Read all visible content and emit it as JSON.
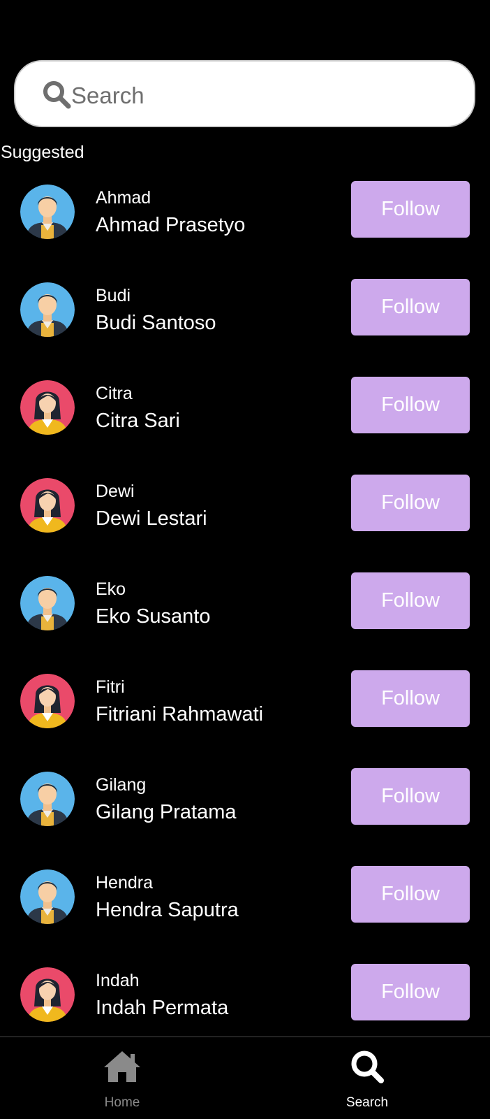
{
  "search": {
    "placeholder": "Search",
    "value": ""
  },
  "section_title": "Suggested",
  "users": [
    {
      "username": "Ahmad",
      "fullname": "Ahmad Prasetyo",
      "avatar": "male-avatar-icon",
      "button": "Follow"
    },
    {
      "username": "Budi",
      "fullname": "Budi Santoso",
      "avatar": "male-avatar-icon",
      "button": "Follow"
    },
    {
      "username": "Citra",
      "fullname": "Citra Sari",
      "avatar": "female-avatar-icon",
      "button": "Follow"
    },
    {
      "username": "Dewi",
      "fullname": "Dewi Lestari",
      "avatar": "female-avatar-icon",
      "button": "Follow"
    },
    {
      "username": "Eko",
      "fullname": "Eko Susanto",
      "avatar": "male-avatar-icon",
      "button": "Follow"
    },
    {
      "username": "Fitri",
      "fullname": "Fitriani Rahmawati",
      "avatar": "female-avatar-icon",
      "button": "Follow"
    },
    {
      "username": "Gilang",
      "fullname": "Gilang Pratama",
      "avatar": "male-avatar-icon",
      "button": "Follow"
    },
    {
      "username": "Hendra",
      "fullname": "Hendra Saputra",
      "avatar": "male-avatar-icon",
      "button": "Follow"
    },
    {
      "username": "Indah",
      "fullname": "Indah Permata",
      "avatar": "female-avatar-icon",
      "button": "Follow"
    }
  ],
  "bottom_nav": {
    "home_label": "Home",
    "search_label": "Search",
    "active": "search"
  },
  "colors": {
    "background": "#000000",
    "follow_button": "#cda9ec",
    "male_avatar_bg": "#5ab4ea",
    "female_avatar_bg": "#ea4a6a",
    "inactive_nav": "#8a8a8a"
  }
}
